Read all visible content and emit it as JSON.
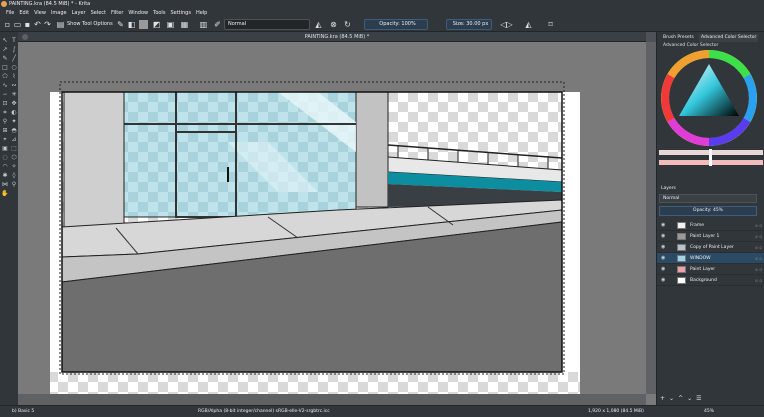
{
  "window": {
    "title": "PAINTING.kra (84.5 MiB) * - Krita"
  },
  "menu": [
    "File",
    "Edit",
    "View",
    "Image",
    "Layer",
    "Select",
    "Filter",
    "Window",
    "Tools",
    "Settings",
    "Help"
  ],
  "toolbar": {
    "show_tool_options": "Show Tool Options",
    "blend_mode": "Normal",
    "opacity": "Opacity: 100%",
    "size": "Size: 30.00 px"
  },
  "document": {
    "tab_title": "PAINTING.kra (84.5 MiB) *"
  },
  "dock": {
    "tabs": [
      "Brush Presets",
      "Advanced Color Selector"
    ],
    "color_selector_label": "Advanced Color Selector",
    "layers_title": "Layers",
    "blend_mode": "Normal",
    "opacity": "Opacity: 45%",
    "layers": [
      {
        "name": "Frame",
        "selected": false,
        "thumb": "#f2f2f2"
      },
      {
        "name": "Paint Layer 1",
        "selected": false,
        "thumb": "#9a9a9a"
      },
      {
        "name": "Copy of Paint Layer",
        "selected": false,
        "thumb": "#b8c4cc"
      },
      {
        "name": "WINDOW",
        "selected": true,
        "thumb": "#9fd4e8"
      },
      {
        "name": "Paint Layer",
        "selected": false,
        "thumb": "#f2a0a8"
      },
      {
        "name": "Background",
        "selected": false,
        "thumb": "#ffffff"
      }
    ],
    "buttons": [
      "+",
      "⌄",
      "^",
      "⌃",
      "⌄",
      "☰"
    ]
  },
  "status": {
    "left": "b) Basic 5",
    "center": "RGB/Alpha (8-bit integer/channel) sRGB-elle-V2-srgbtrc.icc",
    "right_size": "1,920 x 1,080 (84.5 MiB)",
    "zoom": "45%"
  },
  "colors": {
    "accent": "#3daee9",
    "panel": "#31363b",
    "dark": "#232629",
    "canvas_bg": "#7a7a7a"
  }
}
